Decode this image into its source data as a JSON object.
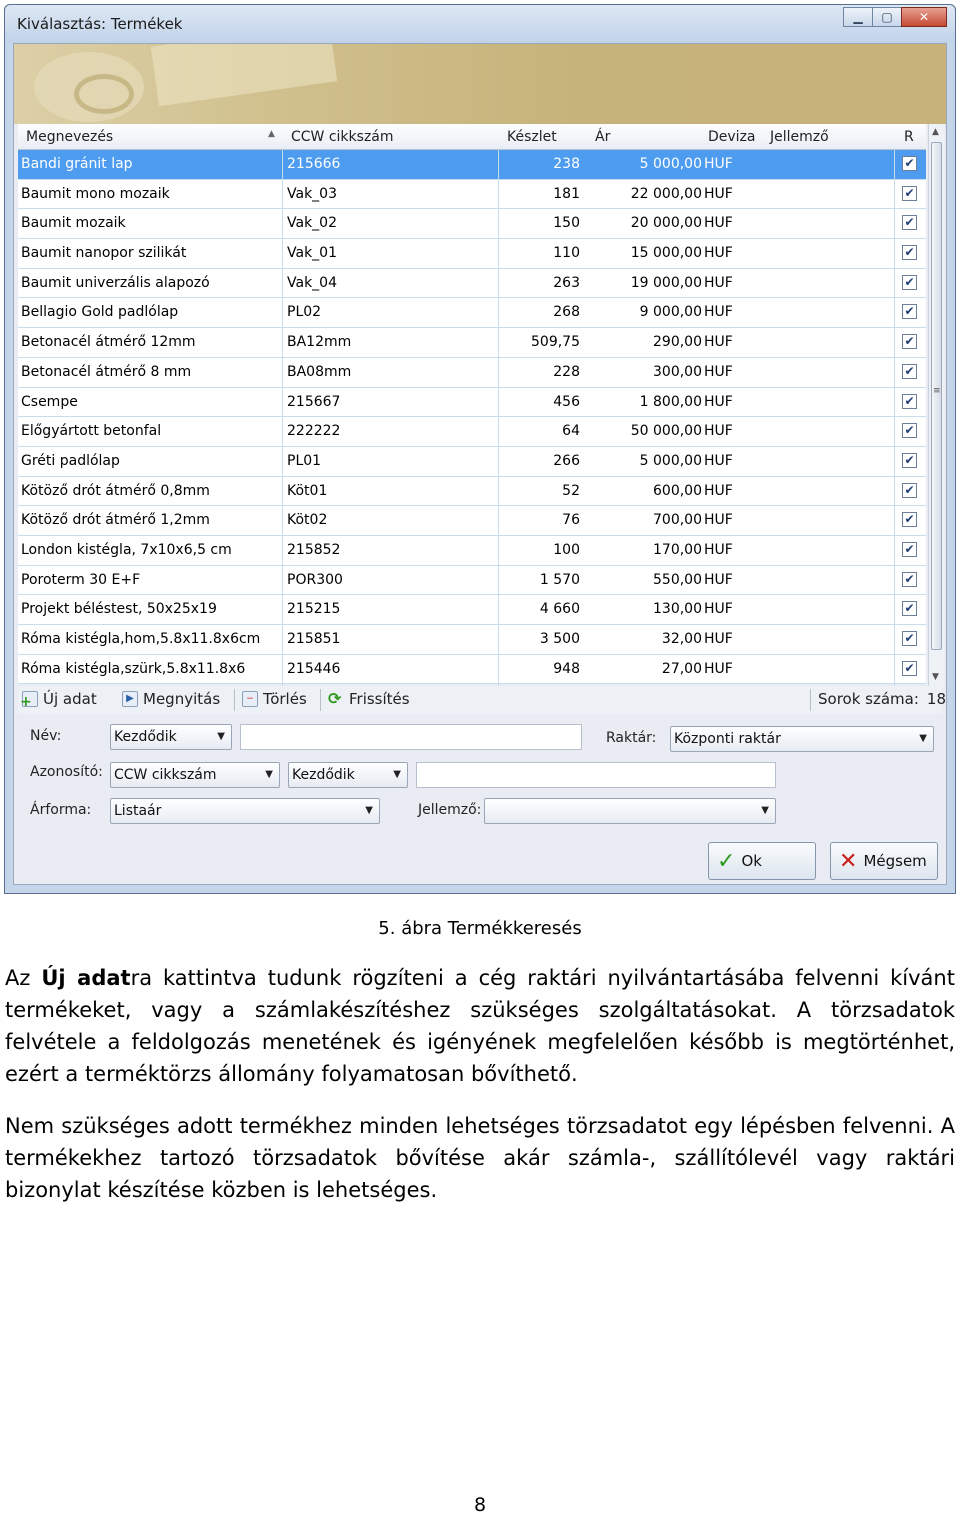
{
  "window": {
    "title": "Kiválasztás: Termékek",
    "controls": {
      "minimize": "▁",
      "maximize": "▢",
      "close": "✕"
    }
  },
  "grid": {
    "columns": [
      "Megnevezés",
      "CCW cikkszám",
      "Készlet",
      "Ár",
      "Deviza",
      "Jellemző",
      "R"
    ],
    "rows": [
      {
        "name": "Bandi gránit lap",
        "code": "215666",
        "stock": "238",
        "price": "5 000,00",
        "currency": "HUF",
        "checked": true,
        "selected": true
      },
      {
        "name": "Baumit mono mozaik",
        "code": "Vak_03",
        "stock": "181",
        "price": "22 000,00",
        "currency": "HUF",
        "checked": true
      },
      {
        "name": "Baumit mozaik",
        "code": "Vak_02",
        "stock": "150",
        "price": "20 000,00",
        "currency": "HUF",
        "checked": true
      },
      {
        "name": "Baumit nanopor szilikát",
        "code": "Vak_01",
        "stock": "110",
        "price": "15 000,00",
        "currency": "HUF",
        "checked": true
      },
      {
        "name": "Baumit univerzális alapozó",
        "code": "Vak_04",
        "stock": "263",
        "price": "19 000,00",
        "currency": "HUF",
        "checked": true
      },
      {
        "name": "Bellagio Gold padlólap",
        "code": "PL02",
        "stock": "268",
        "price": "9 000,00",
        "currency": "HUF",
        "checked": true
      },
      {
        "name": "Betonacél átmérő 12mm",
        "code": "BA12mm",
        "stock": "509,75",
        "price": "290,00",
        "currency": "HUF",
        "checked": true
      },
      {
        "name": "Betonacél átmérő 8 mm",
        "code": "BA08mm",
        "stock": "228",
        "price": "300,00",
        "currency": "HUF",
        "checked": true
      },
      {
        "name": "Csempe",
        "code": "215667",
        "stock": "456",
        "price": "1 800,00",
        "currency": "HUF",
        "checked": true
      },
      {
        "name": "Előgyártott betonfal",
        "code": "222222",
        "stock": "64",
        "price": "50 000,00",
        "currency": "HUF",
        "checked": true
      },
      {
        "name": "Gréti padlólap",
        "code": "PL01",
        "stock": "266",
        "price": "5 000,00",
        "currency": "HUF",
        "checked": true
      },
      {
        "name": "Kötöző drót átmérő 0,8mm",
        "code": "Köt01",
        "stock": "52",
        "price": "600,00",
        "currency": "HUF",
        "checked": true
      },
      {
        "name": "Kötöző drót átmérő 1,2mm",
        "code": "Köt02",
        "stock": "76",
        "price": "700,00",
        "currency": "HUF",
        "checked": true
      },
      {
        "name": "London kistégla, 7x10x6,5 cm",
        "code": "215852",
        "stock": "100",
        "price": "170,00",
        "currency": "HUF",
        "checked": true
      },
      {
        "name": "Poroterm 30 E+F",
        "code": "POR300",
        "stock": "1 570",
        "price": "550,00",
        "currency": "HUF",
        "checked": true
      },
      {
        "name": "Projekt béléstest, 50x25x19",
        "code": "215215",
        "stock": "4 660",
        "price": "130,00",
        "currency": "HUF",
        "checked": true
      },
      {
        "name": "Róma kistégla,hom,5.8x11.8x6cm",
        "code": "215851",
        "stock": "3 500",
        "price": "32,00",
        "currency": "HUF",
        "checked": true
      },
      {
        "name": "Róma kistégla,szürk,5.8x11.8x6",
        "code": "215446",
        "stock": "948",
        "price": "27,00",
        "currency": "HUF",
        "checked": true
      }
    ]
  },
  "toolbar": {
    "new_label": "Új adat",
    "open_label": "Megnyitás",
    "delete_label": "Törlés",
    "refresh_label": "Frissítés",
    "row_count_label": "Sorok száma:",
    "row_count": "18"
  },
  "filters": {
    "name_label": "Név:",
    "name_mode": "Kezdődik",
    "name_value": "",
    "warehouse_label": "Raktár:",
    "warehouse_value": "Központi raktár",
    "id_label": "Azonosító:",
    "id_field": "CCW cikkszám",
    "id_mode": "Kezdődik",
    "id_value": "",
    "price_form_label": "Árforma:",
    "price_form_value": "Listaár",
    "feature_label": "Jellemző:",
    "feature_value": ""
  },
  "buttons": {
    "ok_label": "Ok",
    "cancel_label": "Mégsem"
  },
  "colors": {
    "selection": "#4e9cf0",
    "ok_green": "#2f9a1f",
    "cancel_red": "#c8201a"
  },
  "document": {
    "caption": "5. ábra Termékkeresés",
    "p1_prefix": "Az ",
    "p1_bold": "Új adat",
    "p1_rest": "ra kattintva tudunk rögzíteni a cég raktári nyilvántartásába felvenni kívánt termékeket, vagy a számlakészítéshez szükséges szolgáltatásokat. A törzsadatok felvétele a feldolgozás menetének és igényének megfelelően később is megtörténhet, ezért a terméktörzs állomány folyamatosan bővíthető.",
    "p2": "Nem szükséges adott termékhez minden lehetséges törzsadatot egy lépésben felvenni. A termékekhez tartozó törzsadatok bővítése akár számla-, szállítólevél vagy raktári bizonylat készítése közben is lehetséges.",
    "page_number": "8"
  }
}
